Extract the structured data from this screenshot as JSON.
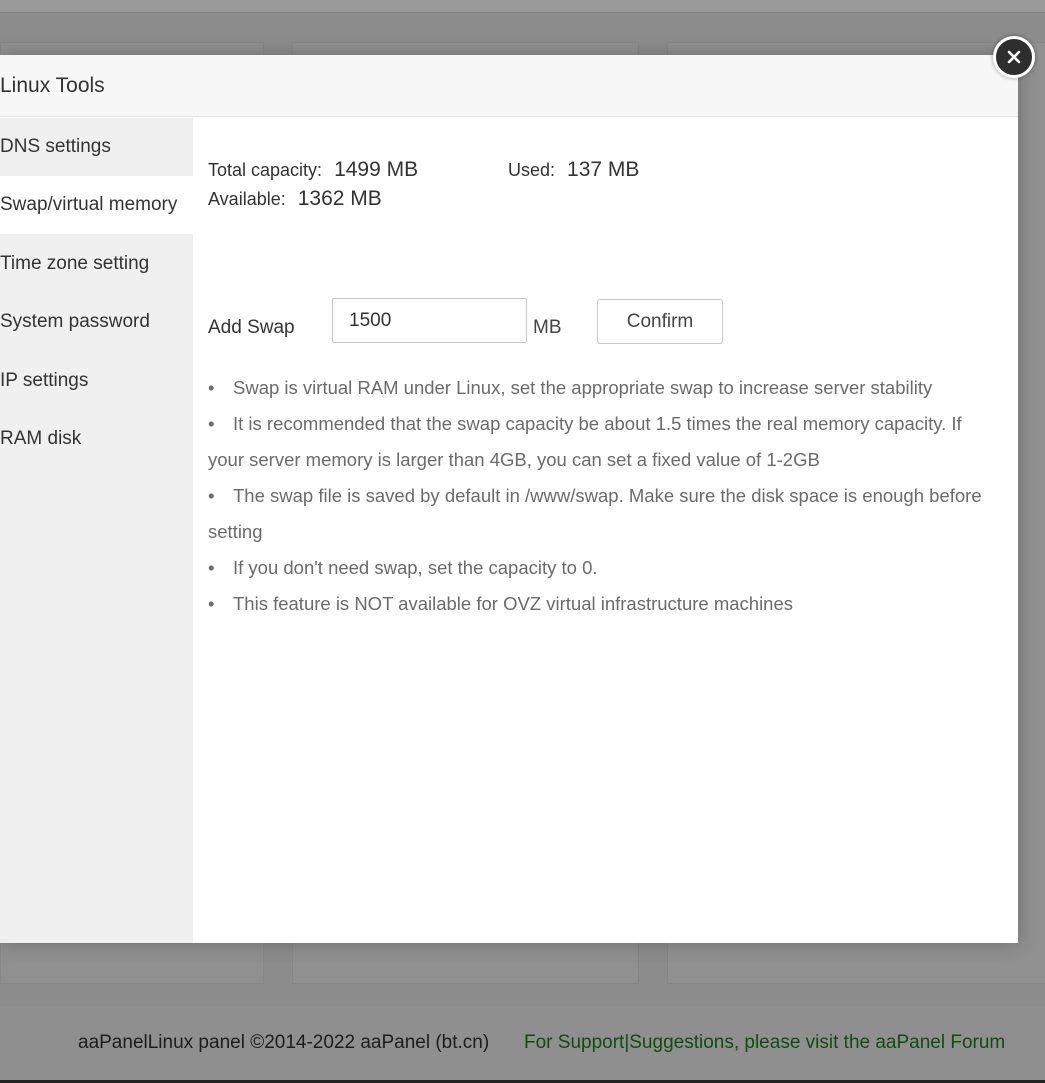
{
  "modal": {
    "title": "Linux Tools",
    "close_icon": "close-icon"
  },
  "sidebar": {
    "items": [
      {
        "label": "DNS settings",
        "active": false
      },
      {
        "label": "Swap/virtual memory",
        "active": true
      },
      {
        "label": "Time zone setting",
        "active": false
      },
      {
        "label": "System password",
        "active": false
      },
      {
        "label": "IP settings",
        "active": false
      },
      {
        "label": "RAM disk",
        "active": false
      }
    ]
  },
  "swap": {
    "total_label": "Total capacity:",
    "total_value": "1499 MB",
    "used_label": "Used:",
    "used_value": "137 MB",
    "available_label": "Available:",
    "available_value": "1362 MB",
    "add_label": "Add Swap",
    "input_value": "1500",
    "unit": "MB",
    "confirm_label": "Confirm",
    "tips": [
      "Swap is virtual RAM under Linux, set the appropriate swap to increase server stability",
      "It is recommended that the swap capacity be about 1.5 times the real memory capacity. If your server memory is larger than 4GB, you can set a fixed value of 1-2GB",
      "The swap file is saved by default in /www/swap. Make sure the disk space is enough before setting",
      "If you don't need swap, set the capacity to 0.",
      "This feature is NOT available for OVZ virtual infrastructure machines"
    ]
  },
  "footer": {
    "copyright": "aaPanelLinux panel ©2014-2022 aaPanel (bt.cn)",
    "support_link": "For Support|Suggestions, please visit the aaPanel Forum"
  },
  "colors": {
    "overlay": "#8c8c8c",
    "sidebar_bg": "#f0f0f0",
    "footer_link": "#0f4d0f"
  }
}
